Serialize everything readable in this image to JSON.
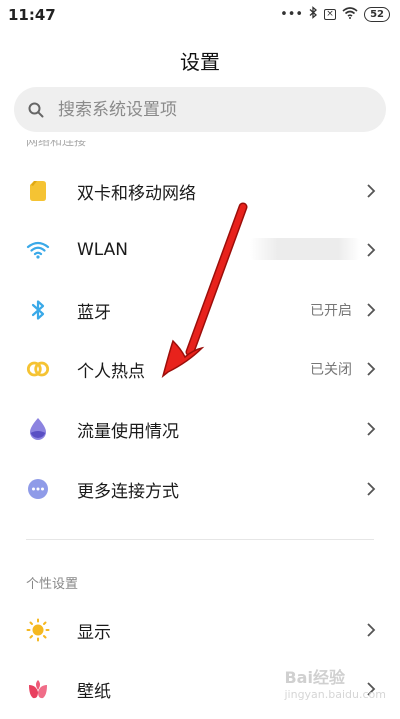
{
  "status": {
    "time": "11:47",
    "icons": [
      "dots-icon",
      "bluetooth-icon",
      "box-x-icon",
      "wifi-icon",
      "battery-icon"
    ],
    "battery": "52",
    "dots": "•••",
    "boxx": "×"
  },
  "page_title": "设置",
  "search": {
    "placeholder": "搜索系统设置项"
  },
  "section_cut": "网络和连接",
  "rows": [
    {
      "label": "双卡和移动网络",
      "value": "",
      "icon": "sim-card-icon",
      "color": "#f5c333"
    },
    {
      "label": "WLAN",
      "value": "",
      "icon": "wifi-icon",
      "color": "#3aa9e8"
    },
    {
      "label": "蓝牙",
      "value": "已开启",
      "icon": "bluetooth-icon",
      "color": "#3aa9e8"
    },
    {
      "label": "个人热点",
      "value": "已关闭",
      "icon": "hotspot-icon",
      "color": "#f5c333"
    },
    {
      "label": "流量使用情况",
      "value": "",
      "icon": "data-drop-icon",
      "color": "#7a6fd8"
    },
    {
      "label": "更多连接方式",
      "value": "",
      "icon": "more-icon",
      "color": "#8f9be8"
    }
  ],
  "section2_label": "个性设置",
  "rows2": [
    {
      "label": "显示",
      "value": "",
      "icon": "sun-icon",
      "color": "#f5b820"
    },
    {
      "label": "壁纸",
      "value": "",
      "icon": "flower-icon",
      "color": "#ee5a78"
    }
  ],
  "watermark": {
    "main": "Bai经验",
    "sub": "jingyan.baidu.com"
  },
  "accent_red": "#e8221c"
}
